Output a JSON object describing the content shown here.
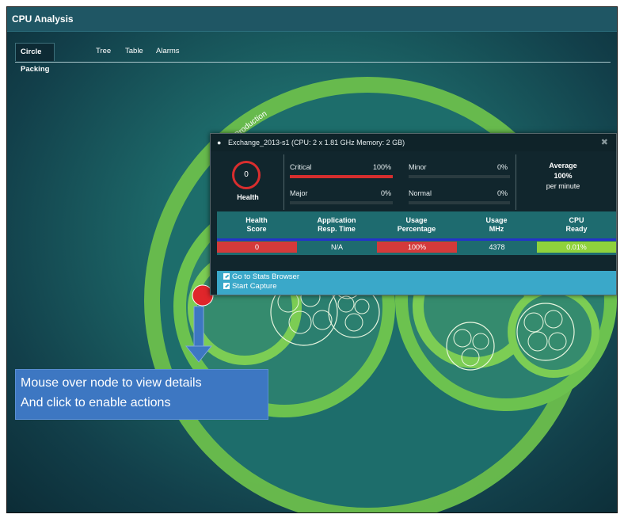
{
  "window": {
    "title": "CPU Analysis"
  },
  "tabs": [
    {
      "label": "Circle Packing",
      "active": true
    },
    {
      "label": "Tree",
      "active": false
    },
    {
      "label": "Table",
      "active": false
    },
    {
      "label": "Alarms",
      "active": false
    }
  ],
  "viz": {
    "root_label": "Production"
  },
  "popup": {
    "header": "Exchange_2013-s1 (CPU: 2 x 1.81 GHz Memory: 2 GB)",
    "health": {
      "value": "0",
      "label": "Health"
    },
    "stats": {
      "critical": {
        "label": "Critical",
        "value": "100%",
        "level": 1.0
      },
      "major": {
        "label": "Major",
        "value": "0%",
        "level": 0
      },
      "minor": {
        "label": "Minor",
        "value": "0%",
        "level": 0
      },
      "normal": {
        "label": "Normal",
        "value": "0%",
        "level": 0
      }
    },
    "average": {
      "label": "Average",
      "value": "100%",
      "unit": "per minute"
    },
    "columns": [
      {
        "h1": "Health",
        "h2": "Score",
        "value": "0",
        "color": "#d43a3a"
      },
      {
        "h1": "Application",
        "h2": "Resp. Time",
        "value": "N/A",
        "color": "#1e6b6f"
      },
      {
        "h1": "Usage",
        "h2": "Percentage",
        "value": "100%",
        "color": "#d43a3a"
      },
      {
        "h1": "Usage",
        "h2": "MHz",
        "value": "4378",
        "color": "#1e6b6f"
      },
      {
        "h1": "CPU",
        "h2": "Ready",
        "value": "0.01%",
        "color": "#8fd23c"
      }
    ],
    "actions": [
      "Go to Stats Browser",
      "Start Capture"
    ]
  },
  "callout": {
    "line1": "Mouse over node to view details",
    "line2": "And click to enable actions"
  },
  "colors": {
    "ring": "#8fd45a",
    "highlight": "#e0262b",
    "callout": "#3d77c2"
  }
}
